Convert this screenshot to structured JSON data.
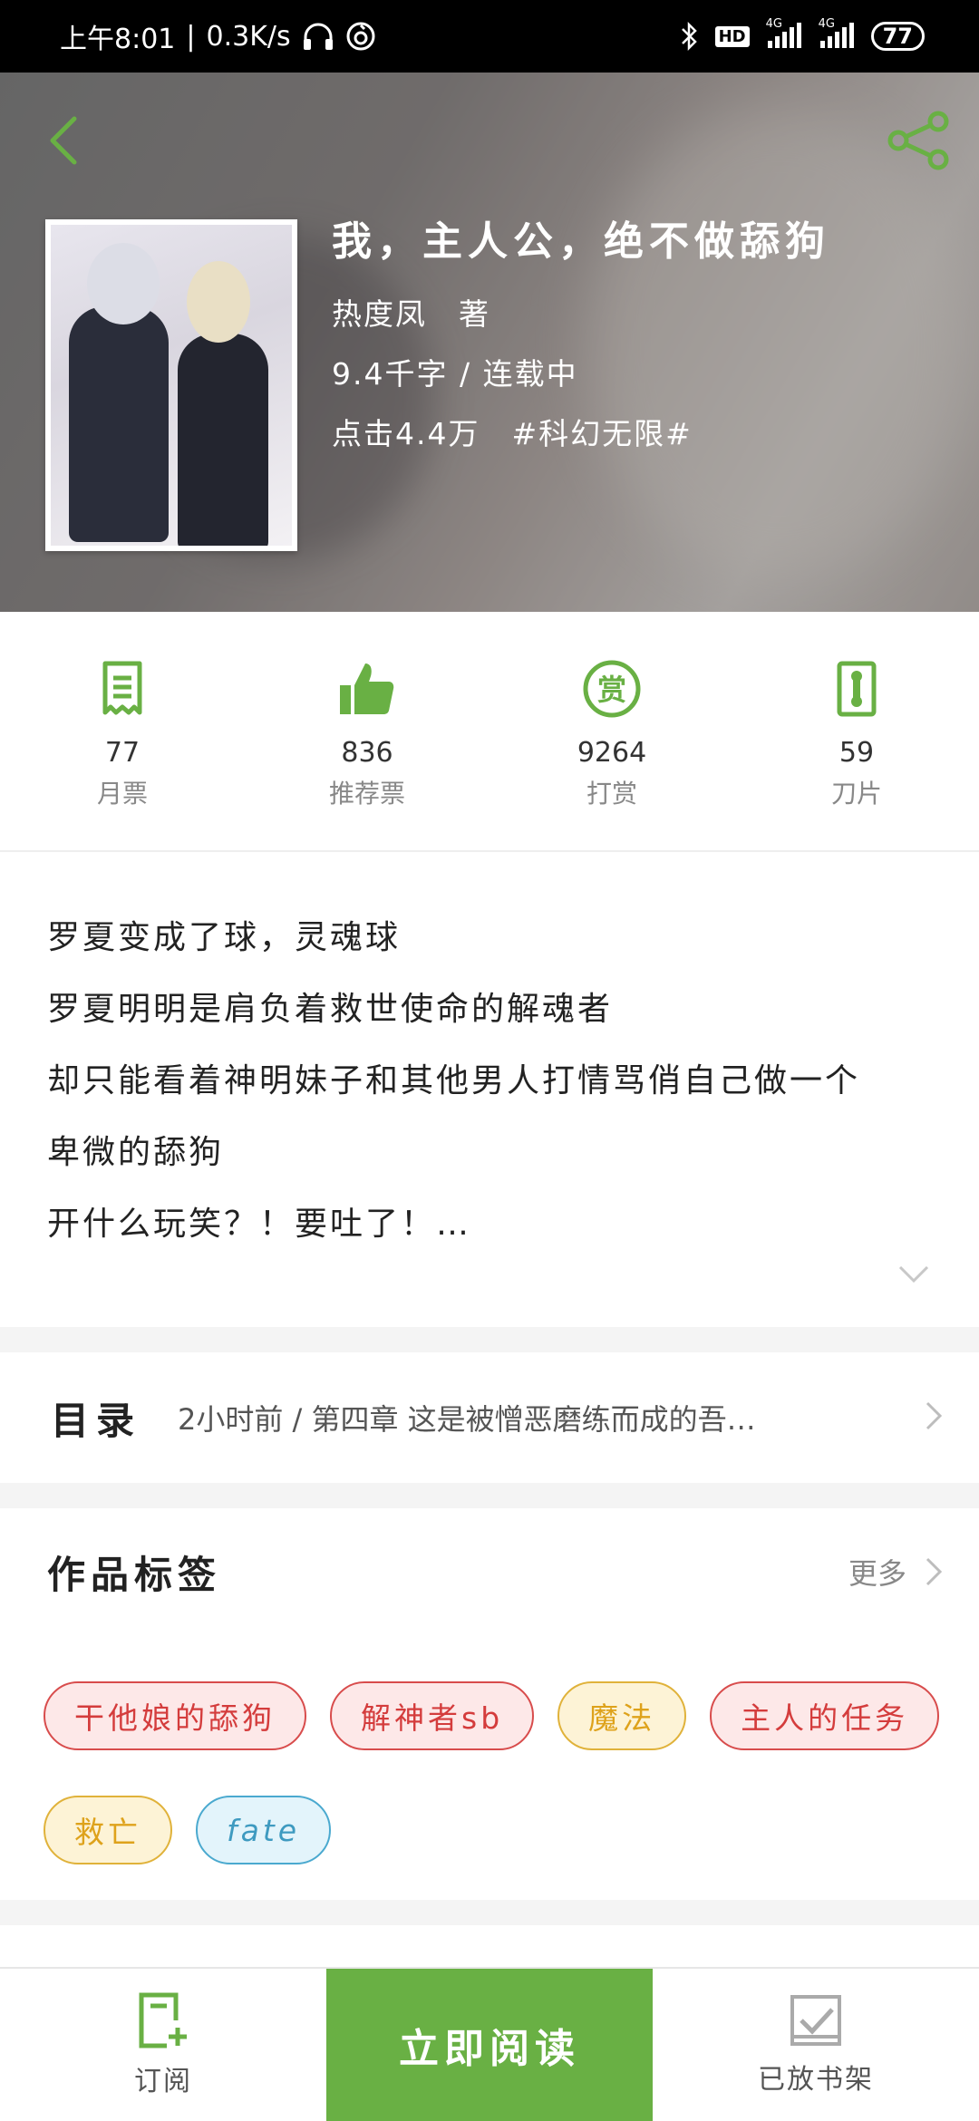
{
  "status_bar": {
    "time": "上午8:01",
    "speed": "0.3K/s",
    "hd": "HD",
    "net1": "4G",
    "net2": "4G",
    "battery": "77"
  },
  "book": {
    "title": "我，主人公，绝不做舔狗",
    "author": "热度凤　著",
    "words_status": "9.4千字 / 连载中",
    "clicks_genre": "点击4.4万　#科幻无限#"
  },
  "stats": [
    {
      "icon": "monthly-ticket-icon",
      "value": "77",
      "label": "月票"
    },
    {
      "icon": "thumbs-up-icon",
      "value": "836",
      "label": "推荐票"
    },
    {
      "icon": "reward-icon",
      "value": "9264",
      "label": "打赏"
    },
    {
      "icon": "blade-icon",
      "value": "59",
      "label": "刀片"
    }
  ],
  "synopsis": [
    "罗夏变成了球，灵魂球",
    "罗夏明明是肩负着救世使命的解魂者",
    "却只能看着神明妹子和其他男人打情骂俏自己做一个",
    "卑微的舔狗",
    "开什么玩笑？！要吐了！…"
  ],
  "catalog": {
    "title": "目录",
    "latest": "2小时前 / 第四章 这是被憎恶磨练而成的吾…"
  },
  "tags": {
    "title": "作品标签",
    "more": "更多",
    "items": [
      {
        "label": "干他娘的舔狗",
        "color": "red"
      },
      {
        "label": "解神者sb",
        "color": "red"
      },
      {
        "label": "魔法",
        "color": "yellow"
      },
      {
        "label": "主人的任务",
        "color": "red"
      },
      {
        "label": "救亡",
        "color": "yellow"
      },
      {
        "label": "fate",
        "color": "blue"
      }
    ]
  },
  "bottom_bar": {
    "subscribe": "订阅",
    "read_now": "立即阅读",
    "shelved": "已放书架"
  },
  "colors": {
    "accent": "#69b044",
    "tag_red": "#d84c4c",
    "tag_yellow": "#e0b23a",
    "tag_blue": "#4aa9cf"
  }
}
